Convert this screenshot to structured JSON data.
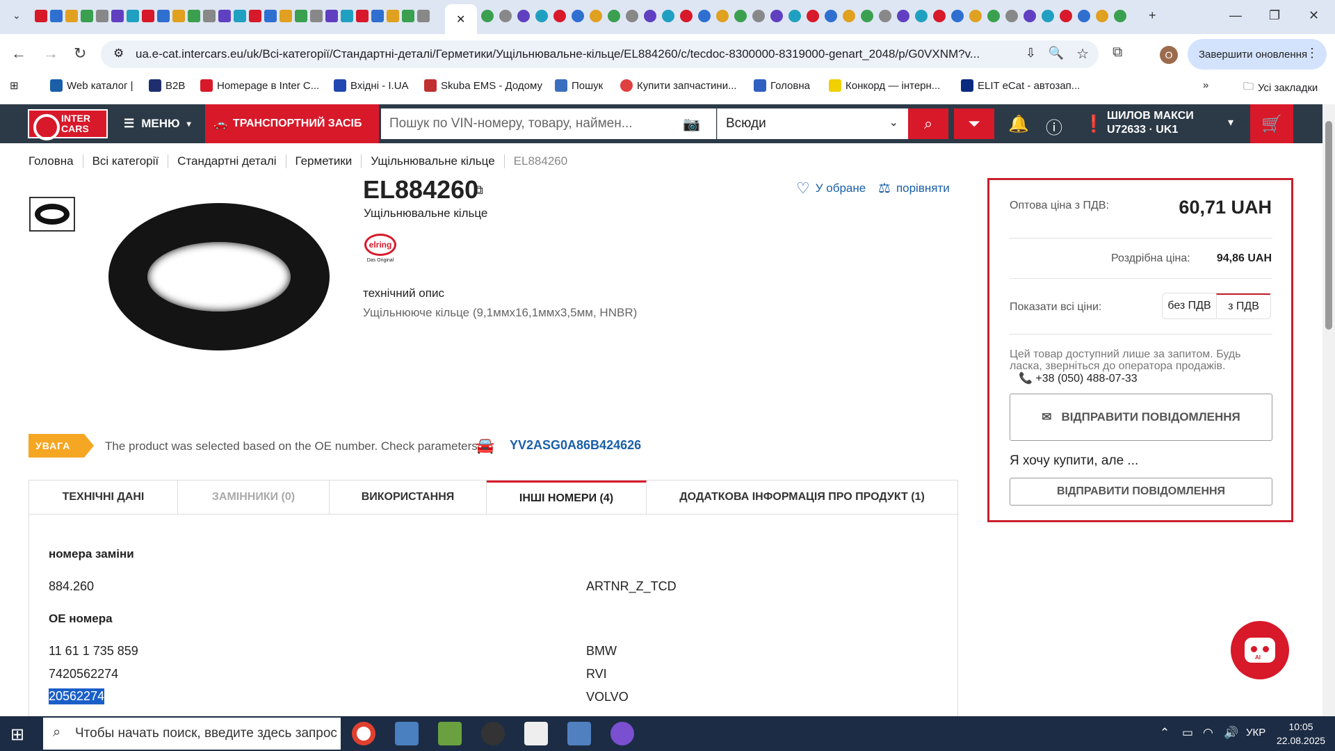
{
  "browser": {
    "url": "ua.e-cat.intercars.eu/uk/Всі-категорії/Стандартні-деталі/Герметики/Ущільнювальне-кільце/EL884260/c/tecdoc-8300000-8319000-genart_2048/p/G0VXNM?v...",
    "update_button": "Завершити оновлення",
    "profile_initial": "O",
    "bookmarks": [
      "Web каталог |",
      "B2B",
      "Homepage в Inter C...",
      "Вхідні - I.UA",
      "Skuba EMS - Додому",
      "Пошук",
      "Купити запчастини...",
      "Головна",
      "Конкорд — інтерн...",
      "ELIT eCat - автозап..."
    ],
    "all_bookmarks": "Усі закладки"
  },
  "header": {
    "logo_text": "INTER CARS",
    "menu_label": "МЕНЮ",
    "vehicle_label": "ТРАНСПОРТНИЙ ЗАСІБ",
    "search_placeholder": "Пошук по VIN-номеру, товару, наймен...",
    "scope": "Всюди",
    "user_name": "ШИЛОВ МАКСИ",
    "user_code": "U72633 · UK1"
  },
  "breadcrumb": [
    "Головна",
    "Всі категорії",
    "Стандартні деталі",
    "Герметики",
    "Ущільнювальне кільце",
    "EL884260"
  ],
  "product": {
    "part_number": "EL884260",
    "name": "Ущільнювальне кільце",
    "brand_logo_text": "elring",
    "brand_tagline": "Das Original",
    "desc_label": "технічний опис",
    "desc_text": "Ущільнююче кільце (9,1ммx16,1ммx3,5мм, HNBR)",
    "favorite_label": "У обране",
    "compare_label": "порівняти"
  },
  "warning": {
    "badge": "УВАГА",
    "text": "The product was selected based on the OE number. Check parameters",
    "vin": "YV2ASG0A86B424626"
  },
  "tabs": [
    {
      "label": "ТЕХНІЧНІ ДАНІ"
    },
    {
      "label": "ЗАМІННИКИ (0)"
    },
    {
      "label": "ВИКОРИСТАННЯ"
    },
    {
      "label": "ІНШІ НОМЕРИ (4)"
    },
    {
      "label": "ДОДАТКОВА ІНФОРМАЦІЯ ПРО ПРОДУКТ (1)"
    }
  ],
  "other_numbers": {
    "replacement_heading": "номера заміни",
    "replacement": [
      {
        "number": "884.260",
        "source": "ARTNR_Z_TCD"
      }
    ],
    "oe_heading": "ОЕ номера",
    "oe": [
      {
        "number": "11 61 1 735 859",
        "source": "BMW"
      },
      {
        "number": "7420562274",
        "source": "RVI"
      },
      {
        "number": "20562274",
        "source": "VOLVO"
      }
    ]
  },
  "price": {
    "wholesale_label": "Оптова ціна з ПДВ:",
    "wholesale_value": "60,71 UAH",
    "retail_label": "Роздрібна ціна:",
    "retail_value": "94,86 UAH",
    "show_prices_label": "Показати всі ціни:",
    "vat_off": "без ПДВ",
    "vat_on": "з ПДВ",
    "note": "Цей товар доступний лише за запитом. Будь ласка, зверніться до оператора продажів.",
    "phone": "+38 (050) 488-07-33",
    "send_message": "ВІДПРАВИТИ ПОВІДОМЛЕННЯ",
    "want_buy": "Я хочу купити, але ...",
    "send_message2": "ВІДПРАВИТИ ПОВІДОМЛЕННЯ"
  },
  "chatbot_label": "AI",
  "taskbar": {
    "search_placeholder": "Чтобы начать поиск, введите здесь запрос",
    "lang": "УКР",
    "time": "10:05",
    "date": "22.08.2025"
  }
}
